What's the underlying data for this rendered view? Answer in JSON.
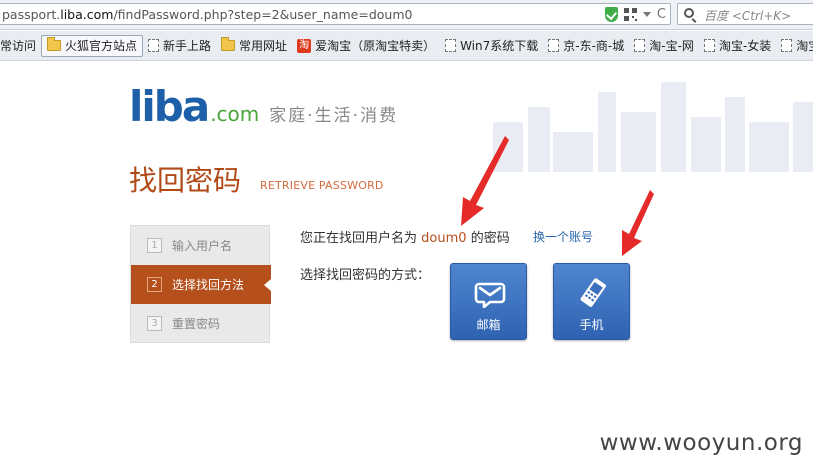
{
  "browser": {
    "url_prefix": "passport.",
    "url_domain": "liba.com",
    "url_path": "/findPassword.php?step=2&user_name=doum0",
    "search_placeholder": "百度 <Ctrl+K>"
  },
  "bookmarks": [
    {
      "label": "常访问",
      "icon": "none"
    },
    {
      "label": "火狐官方站点",
      "icon": "folder-icon"
    },
    {
      "label": "新手上路",
      "icon": "page-icon"
    },
    {
      "label": "常用网址",
      "icon": "folder-icon"
    },
    {
      "label": "爱淘宝（原淘宝特卖）",
      "icon": "taobao-icon"
    },
    {
      "label": "Win7系统下载",
      "icon": "page-icon"
    },
    {
      "label": "京-东-商-城",
      "icon": "page-icon"
    },
    {
      "label": "淘-宝-网",
      "icon": "page-icon"
    },
    {
      "label": "淘宝-女装",
      "icon": "page-icon"
    },
    {
      "label": "淘宝",
      "icon": "page-icon"
    }
  ],
  "logo": {
    "main": "liba",
    "domain": ".com",
    "slogan": "家庭·生活·消费"
  },
  "page": {
    "title": "找回密码",
    "subtitle": "RETRIEVE PASSWORD"
  },
  "steps": [
    {
      "num": "1",
      "label": "输入用户名"
    },
    {
      "num": "2",
      "label": "选择找回方法"
    },
    {
      "num": "3",
      "label": "重置密码"
    }
  ],
  "info": {
    "prefix": "您正在找回用户名为",
    "username": "doum0",
    "suffix": "的密码",
    "switch_link": "换一个账号"
  },
  "method_prompt": "选择找回密码的方式：",
  "methods": [
    {
      "label": "邮箱",
      "icon": "mail-icon"
    },
    {
      "label": "手机",
      "icon": "mobile-phone-icon"
    }
  ],
  "watermark": "www.wooyun.org",
  "colors": {
    "accent": "#b5501d",
    "method_blue": "#3a70be",
    "link": "#2a64ad",
    "annotation_red": "#e52a2a"
  }
}
